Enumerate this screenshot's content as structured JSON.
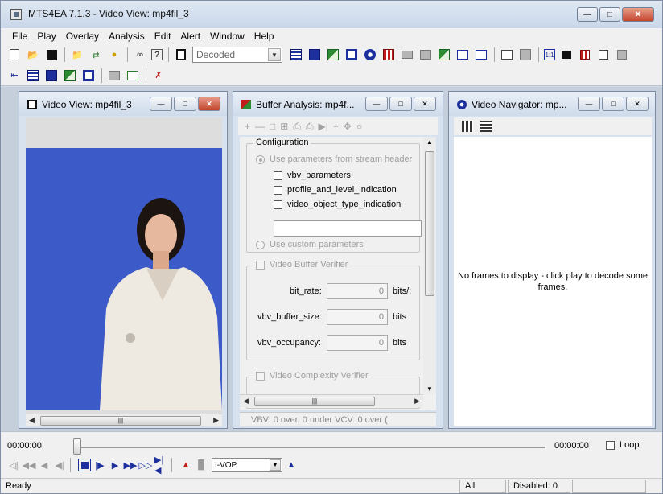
{
  "window": {
    "title": "MTS4EA 7.1.3 - Video View: mp4fil_3"
  },
  "menu": [
    "File",
    "Play",
    "Overlay",
    "Analysis",
    "Edit",
    "Alert",
    "Window",
    "Help"
  ],
  "toolbar": {
    "view_mode": "Decoded"
  },
  "video_view": {
    "title": "Video View: mp4fil_3"
  },
  "buffer_analysis": {
    "title": "Buffer Analysis: mp4f...",
    "configuration_label": "Configuration",
    "use_stream_header": "Use parameters from stream header",
    "vbv_parameters": "vbv_parameters",
    "profile_level": "profile_and_level_indication",
    "video_object_type": "video_object_type_indication",
    "use_custom": "Use custom parameters",
    "vbv_verifier_label": "Video Buffer Verifier",
    "bit_rate_label": "bit_rate:",
    "bit_rate_value": "0",
    "bit_rate_unit": "bits/:",
    "vbv_buffer_size_label": "vbv_buffer_size:",
    "vbv_buffer_size_value": "0",
    "vbv_buffer_size_unit": "bits",
    "vbv_occupancy_label": "vbv_occupancy:",
    "vbv_occupancy_value": "0",
    "vbv_occupancy_unit": "bits",
    "complexity_verifier_label": "Video Complexity Verifier",
    "status": "VBV: 0 over, 0 under     VCV: 0 over    ("
  },
  "navigator": {
    "title": "Video Navigator: mp...",
    "message": "No frames to display - click play to decode some frames."
  },
  "playback": {
    "time_start": "00:00:00",
    "time_end": "00:00:00",
    "loop_label": "Loop",
    "frame_type": "I-VOP"
  },
  "statusbar": {
    "ready": "Ready",
    "filter": "All",
    "disabled": "Disabled: 0"
  }
}
